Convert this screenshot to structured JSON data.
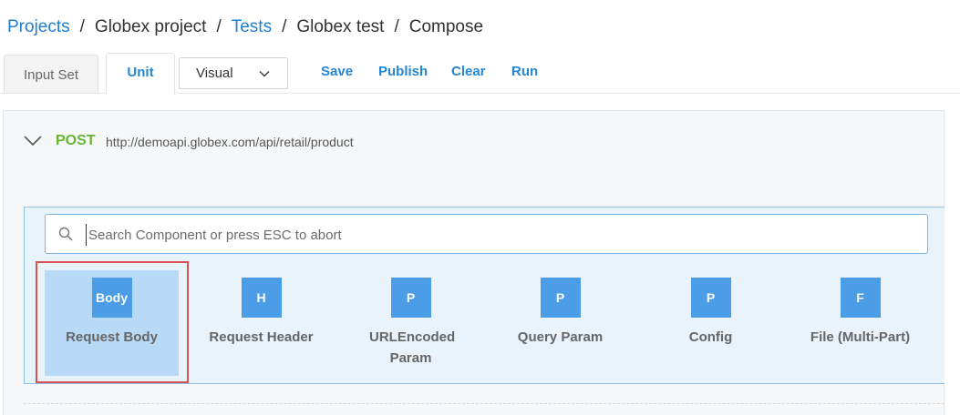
{
  "breadcrumb": {
    "projects": "Projects",
    "project": "Globex project",
    "tests": "Tests",
    "test": "Globex test",
    "page": "Compose",
    "separator": "/"
  },
  "tabs": {
    "input_set": "Input Set",
    "unit": "Unit"
  },
  "view_select": {
    "value": "Visual",
    "icon": "chevron-down-icon"
  },
  "actions": {
    "save": "Save",
    "publish": "Publish",
    "clear": "Clear",
    "run": "Run"
  },
  "request": {
    "method": "POST",
    "url": "http://demoapi.globex.com/api/retail/product",
    "collapse_icon": "chevron-down-icon"
  },
  "search": {
    "placeholder": "Search Component or press ESC to abort",
    "value": "",
    "icon": "search-icon"
  },
  "components": [
    {
      "badge": "Body",
      "label": "Request Body",
      "selected": true
    },
    {
      "badge": "H",
      "label": "Request Header",
      "selected": false
    },
    {
      "badge": "P",
      "label": "URLEncoded Param",
      "selected": false
    },
    {
      "badge": "P",
      "label": "Query Param",
      "selected": false
    },
    {
      "badge": "P",
      "label": "Config",
      "selected": false
    },
    {
      "badge": "F",
      "label": "File (Multi-Part)",
      "selected": false
    }
  ],
  "colors": {
    "link": "#1f7fd3",
    "action": "#2486d6",
    "method": "#66b532",
    "badge": "#4b9de8",
    "selected_bg": "#b9daf7",
    "highlight": "#d9534f"
  }
}
